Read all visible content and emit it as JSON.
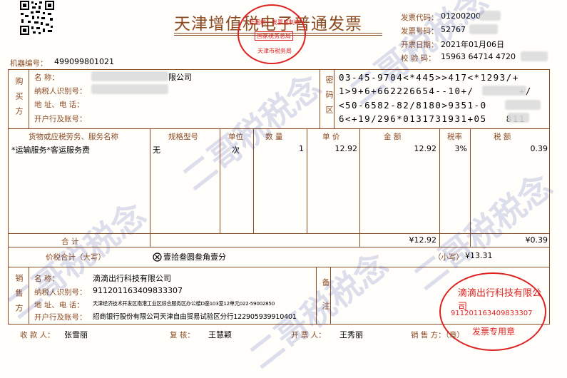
{
  "title": "天津增值税电子普通发票",
  "header": {
    "code_label": "发票代码：",
    "code_value": "01200200",
    "number_label": "发票号码：",
    "number_value": "52767",
    "date_label": "开票日期：",
    "date_value": "2021年01月06日",
    "check_label": "校  验  码：",
    "check_value": "15963 64714 4720"
  },
  "machine_label": "机器编号：",
  "machine_value": "499099801021",
  "stamp_top": {
    "line1": "全国统一发票监制章",
    "line2": "国家税务总局",
    "line3": "天津市税务局"
  },
  "buyer": {
    "side_label": "购买方",
    "name_label": "名      称：",
    "name_value": "限公司",
    "tax_label": "纳税人识别号：",
    "addr_label": "地 址、电 话：",
    "bank_label": "开户行及账号："
  },
  "cipher": {
    "side_label": "密码区",
    "lines": [
      "03-45-9704<*445>>417<*1293/+",
      "1>9+6+662226654--10+/       +/",
      "<50-6582-82/8180>9351-0",
      "6<+19/296*0131731931+05   811"
    ]
  },
  "items": {
    "headers": [
      "货物或应税劳务、服务名称",
      "规格型号",
      "单位",
      "数  量",
      "单  价",
      "金  额",
      "税率",
      "税  额"
    ],
    "rows": [
      {
        "name": "*运输服务*客运服务费",
        "spec": "无",
        "unit": "次",
        "qty": "1",
        "price": "12.92",
        "amount": "12.92",
        "rate": "3%",
        "tax": "0.39"
      }
    ],
    "total_label": "合        计",
    "total_amount": "¥12.92",
    "total_tax": "¥0.39"
  },
  "sum": {
    "label": "价税合计（大写）",
    "icon": "circle-x-icon",
    "upper": "壹拾叁圆叁角壹分",
    "lower_label": "（小写）",
    "lower_value": "¥13.31"
  },
  "seller": {
    "side_label": "销售方",
    "name_label": "名      称：",
    "name_value": "滴滴出行科技有限公司",
    "tax_label": "纳税人识别号：",
    "tax_value": "911201163409833307",
    "addr_label": "地 址、电 话：",
    "addr_value": "天津经济技术开发区南港工业区综合服务区办公楼D座103室12单元022-59002850",
    "bank_label": "开户行及账号：",
    "bank_value": "招商银行股份有限公司天津自由贸易试验区分行122905939910401"
  },
  "remark": {
    "side_label": "备注"
  },
  "stamp_seller": {
    "line1": "滴滴出行科技有限公司",
    "line2": "911201163409833307",
    "line3": "发票专用章"
  },
  "footer": {
    "payee_label": "收 款 人：",
    "payee_value": "张雪丽",
    "review_label": "复 核：",
    "review_value": "王慧颖",
    "drawer_label": "开 票 人：",
    "drawer_value": "王秀丽",
    "seller_label": "销 售 方：（章）"
  },
  "watermark": "二哥税税念"
}
